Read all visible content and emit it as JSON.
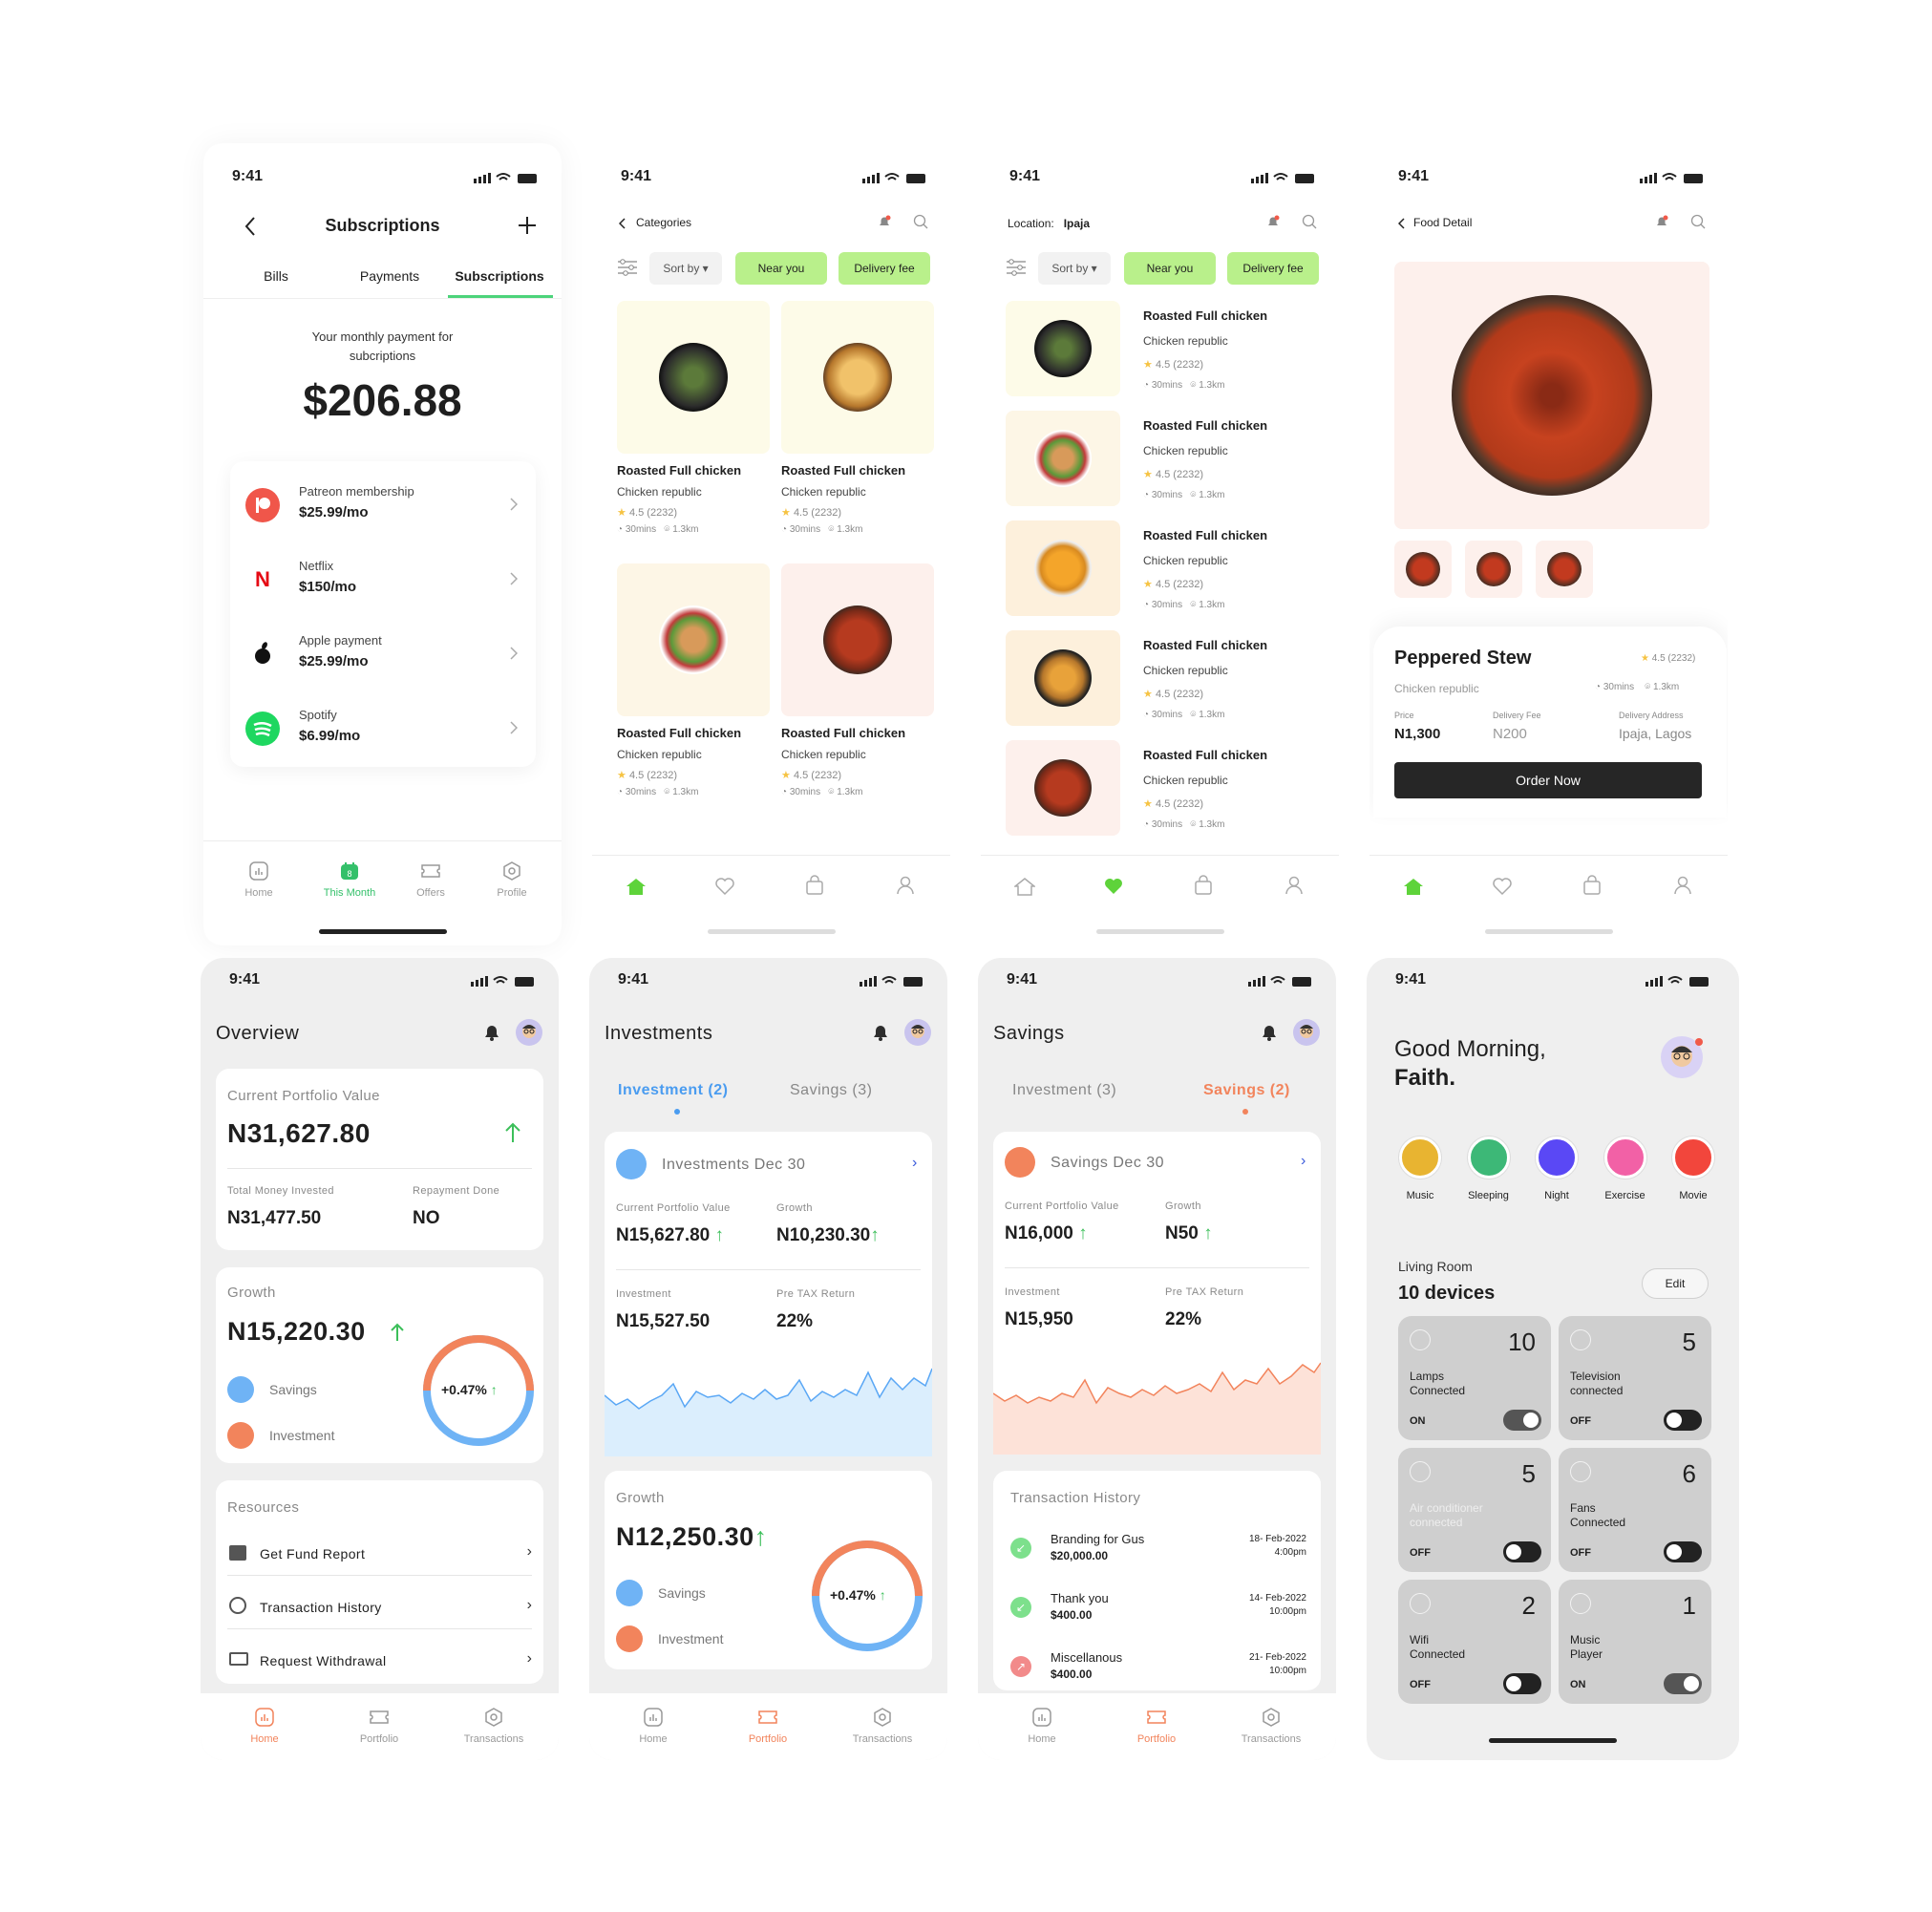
{
  "status": {
    "time": "9:41"
  },
  "subs": {
    "title": "Subscriptions",
    "tabs": [
      "Bills",
      "Payments",
      "Subscriptions"
    ],
    "monthly_label": "Your monthly payment for subcriptions",
    "amount": "$206.88",
    "items": [
      {
        "name": "Patreon membership",
        "price": "$25.99/mo"
      },
      {
        "name": "Netflix",
        "price": "$150/mo"
      },
      {
        "name": "Apple payment",
        "price": "$25.99/mo"
      },
      {
        "name": "Spotify",
        "price": "$6.99/mo"
      }
    ],
    "nav": [
      "Home",
      "This Month",
      "Offers",
      "Profile"
    ],
    "nav_badge": "8"
  },
  "categories": {
    "back_label": "Categories",
    "sort": "Sort by",
    "near": "Near you",
    "fee": "Delivery fee",
    "card": {
      "name": "Roasted Full chicken",
      "shop": "Chicken republic",
      "rating": "4.5 (2232)",
      "time": "30mins",
      "dist": "1.3km"
    }
  },
  "location": {
    "label": "Location:",
    "place": "Ipaja"
  },
  "detail": {
    "back_label": "Food Detail",
    "name": "Peppered Stew",
    "shop": "Chicken republic",
    "rating": "4.5 (2232)",
    "time": "30mins",
    "dist": "1.3km",
    "price_l": "Price",
    "price": "N1,300",
    "fee_l": "Delivery Fee",
    "fee": "N200",
    "addr_l": "Delivery Address",
    "addr": "Ipaja, Lagos",
    "order": "Order Now"
  },
  "overview": {
    "title": "Overview",
    "cpv_l": "Current Portfolio Value",
    "cpv": "N31,627.80",
    "tmi_l": "Total Money Invested",
    "tmi": "N31,477.50",
    "rd_l": "Repayment Done",
    "rd": "NO",
    "growth_l": "Growth",
    "growth": "N15,220.30",
    "pct": "+0.47%",
    "savings": "Savings",
    "investment": "Investment",
    "res_l": "Resources",
    "res": [
      "Get Fund Report",
      "Transaction History",
      "Request Withdrawal"
    ],
    "nav": [
      "Home",
      "Portfolio",
      "Transactions"
    ]
  },
  "invest": {
    "title": "Investments",
    "tab1": "Investment (2)",
    "tab2": "Savings (3)",
    "head": "Investments Dec 30",
    "cpv_l": "Current Portfolio Value",
    "cpv": "N15,627.80",
    "gr_l": "Growth",
    "gr": "N10,230.30",
    "inv_l": "Investment",
    "inv": "N15,527.50",
    "ptr_l": "Pre TAX Return",
    "ptr": "22%",
    "growth_l": "Growth",
    "growth": "N12,250.30",
    "pct": "+0.47%"
  },
  "savings": {
    "title": "Savings",
    "tab1": "Investment (3)",
    "tab2": "Savings (2)",
    "head": "Savings Dec 30",
    "cpv_l": "Current Portfolio Value",
    "cpv": "N16,000",
    "gr_l": "Growth",
    "gr": "N50",
    "inv_l": "Investment",
    "inv": "N15,950",
    "ptr_l": "Pre TAX Return",
    "ptr": "22%",
    "th": "Transaction History",
    "tx": [
      {
        "name": "Branding for Gus",
        "amt": "$20,000.00",
        "date": "18- Feb-2022",
        "time": "4:00pm"
      },
      {
        "name": "Thank you",
        "amt": "$400.00",
        "date": "14- Feb-2022",
        "time": "10:00pm"
      },
      {
        "name": "Miscellanous",
        "amt": "$400.00",
        "date": "21- Feb-2022",
        "time": "10:00pm"
      }
    ]
  },
  "home": {
    "greet1": "Good Morning,",
    "greet2": "Faith.",
    "modes": [
      "Music",
      "Sleeping",
      "Night",
      "Exercise",
      "Movie"
    ],
    "room": "Living Room",
    "devices": "10 devices",
    "edit": "Edit",
    "tiles": [
      {
        "n": "10",
        "t1": "Lamps",
        "t2": "Connected",
        "s": "ON"
      },
      {
        "n": "5",
        "t1": "Television",
        "t2": "connected",
        "s": "OFF"
      },
      {
        "n": "5",
        "t1": "Air conditioner",
        "t2": "connected",
        "s": "OFF"
      },
      {
        "n": "6",
        "t1": "Fans",
        "t2": "Connected",
        "s": "OFF"
      },
      {
        "n": "2",
        "t1": "Wifi",
        "t2": "Connected",
        "s": "OFF"
      },
      {
        "n": "1",
        "t1": "Music",
        "t2": "Player",
        "s": "ON"
      }
    ]
  },
  "colors": {
    "green": "#b9f08b",
    "blue": "#5aa7f5",
    "orange": "#f2845c",
    "mint": "#4cd37a"
  }
}
